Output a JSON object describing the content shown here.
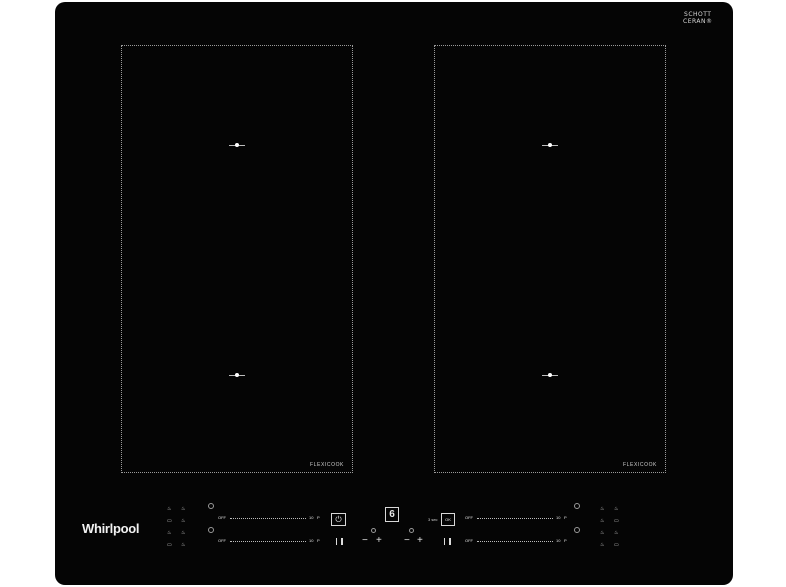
{
  "brand_corner": {
    "line1": "SCHOTT",
    "line2": "CERAN®"
  },
  "zones": {
    "left": {
      "label": "FLEXICOOK"
    },
    "right": {
      "label": "FLEXICOOK"
    }
  },
  "logo": "Whirlpool",
  "sliders": {
    "top_left": {
      "off": "OFF",
      "max": "10",
      "boost": "P"
    },
    "bottom_left": {
      "off": "OFF",
      "max": "10",
      "boost": "P"
    },
    "top_right": {
      "off": "OFF",
      "max": "10",
      "boost": "P"
    },
    "bottom_right": {
      "off": "OFF",
      "max": "10",
      "boost": "P"
    }
  },
  "controls": {
    "power_icon": "power-icon",
    "six_sense": "6",
    "ok_label": "OK",
    "lock_label": "3 sec",
    "minus": "−",
    "plus": "+"
  },
  "function_icons": {
    "left_col1": [
      "♨",
      "▭",
      "♨",
      "▭"
    ],
    "left_col2": [
      "♨",
      "♨",
      "♨",
      "♨"
    ],
    "right_col1": [
      "♨",
      "♨",
      "♨",
      "♨"
    ],
    "right_col2": [
      "♨",
      "▭",
      "♨",
      "▭"
    ]
  }
}
